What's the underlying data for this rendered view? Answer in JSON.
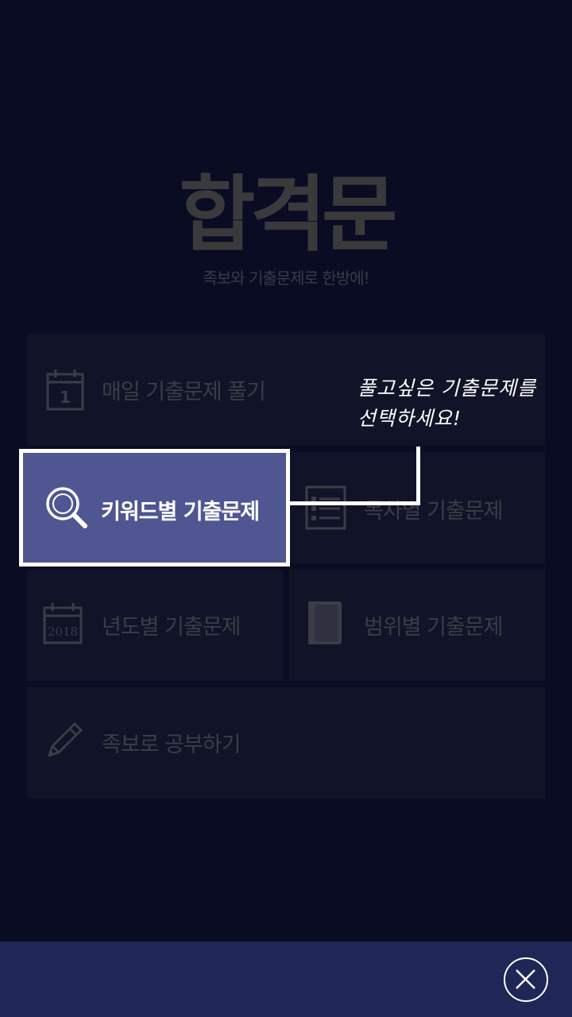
{
  "brand": {
    "logo": "합격문",
    "slogan": "족보와 기출문제로 한방에!"
  },
  "menu": {
    "daily": {
      "label": "매일 기출문제 풀기",
      "icon": "calendar-icon",
      "icon_text": "1"
    },
    "keyword": {
      "label": "키워드별 기출문제",
      "icon": "search-icon"
    },
    "toc": {
      "label": "목차별 기출문제",
      "icon": "list-icon"
    },
    "year": {
      "label": "년도별 기출문제",
      "icon": "calendar-year-icon",
      "icon_text": "2018"
    },
    "range": {
      "label": "범위별 기출문제",
      "icon": "book-icon"
    },
    "jokbo": {
      "label": "족보로 공부하기",
      "icon": "pencil-icon"
    }
  },
  "tooltip": {
    "line1": "풀고싶은 기출문제를",
    "line2": "선택하세요!"
  },
  "footer": {
    "close_icon": "close-icon"
  },
  "colors": {
    "background": "#0a0c24",
    "tile": "#111428",
    "highlight": "#4f5692",
    "bottom_bar": "#1e2756"
  }
}
